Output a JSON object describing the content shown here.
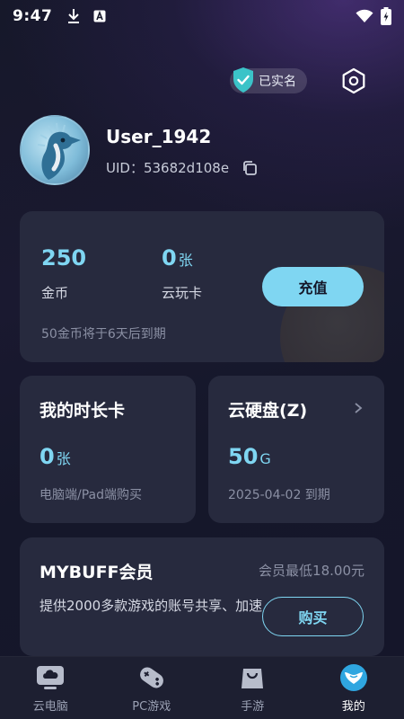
{
  "status_bar": {
    "time": "9:47",
    "download_icon": "download-icon",
    "a_icon": "a-badge-icon",
    "wifi_icon": "wifi-icon",
    "battery_icon": "battery-charging-icon"
  },
  "header": {
    "verified_label": "已实名",
    "verified_icon": "shield-check-icon",
    "settings_icon": "settings-hexagon-icon"
  },
  "profile": {
    "username": "User_1942",
    "uid_label": "UID：",
    "uid_value": "53682d108e",
    "copy_icon": "copy-icon"
  },
  "wallet": {
    "coins_value": "250",
    "coins_label": "金币",
    "cards_value": "0",
    "cards_unit": "张",
    "cards_label": "云玩卡",
    "recharge_label": "充值",
    "note": "50金币将于6天后到期"
  },
  "time_card": {
    "title": "我的时长卡",
    "value": "0",
    "unit": "张",
    "subtitle": "电脑端/Pad端购买"
  },
  "cloud_disk": {
    "title": "云硬盘(Z)",
    "value": "50",
    "unit": "G",
    "subtitle": "2025-04-02 到期"
  },
  "vip": {
    "title": "MYBUFF会员",
    "price_note": "会员最低18.00元",
    "description": "提供2000多款游戏的账号共享、加速",
    "buy_label": "购买"
  },
  "tabs": [
    {
      "label": "云电脑",
      "icon": "cloud-pc-icon",
      "active": false
    },
    {
      "label": "PC游戏",
      "icon": "gamepad-icon",
      "active": false
    },
    {
      "label": "手游",
      "icon": "shopping-bag-icon",
      "active": false
    },
    {
      "label": "我的",
      "icon": "profile-logo-icon",
      "active": true
    }
  ],
  "colors": {
    "accent": "#7fd6f2",
    "card": "#272a3e",
    "background": "#16182a"
  }
}
